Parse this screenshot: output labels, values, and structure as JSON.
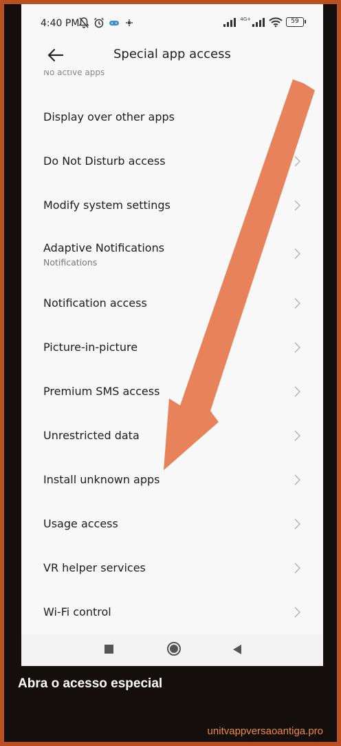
{
  "status_bar": {
    "time": "4:40 PM",
    "network_label": "4G+",
    "battery": "59"
  },
  "header": {
    "title": "Special app access",
    "back_icon": "arrow-left-icon"
  },
  "partial_top_subtitle": "No active apps",
  "items": [
    {
      "label": "Display over other apps",
      "subtitle": "",
      "chevron": false
    },
    {
      "label": "Do Not Disturb access",
      "subtitle": "",
      "chevron": true
    },
    {
      "label": "Modify system settings",
      "subtitle": "",
      "chevron": true
    },
    {
      "label": "Adaptive Notifications",
      "subtitle": "Notifications",
      "chevron": true
    },
    {
      "label": "Notification access",
      "subtitle": "",
      "chevron": true
    },
    {
      "label": "Picture-in-picture",
      "subtitle": "",
      "chevron": true
    },
    {
      "label": "Premium SMS access",
      "subtitle": "",
      "chevron": true
    },
    {
      "label": "Unrestricted data",
      "subtitle": "",
      "chevron": true
    },
    {
      "label": "Install unknown apps",
      "subtitle": "",
      "chevron": true
    },
    {
      "label": "Usage access",
      "subtitle": "",
      "chevron": true
    },
    {
      "label": "VR helper services",
      "subtitle": "",
      "chevron": true
    },
    {
      "label": "Wi-Fi control",
      "subtitle": "",
      "chevron": true
    }
  ],
  "nav_bar": {
    "recents_icon": "square-icon",
    "home_icon": "circle-icon",
    "back_icon": "triangle-back-icon"
  },
  "overlay": {
    "arrow_color": "#e8825a",
    "caption": "Abra o acesso especial",
    "watermark": "unitvappversaoantiga.pro",
    "border_color": "#b8501f",
    "watermark_color": "#f08a3c"
  }
}
